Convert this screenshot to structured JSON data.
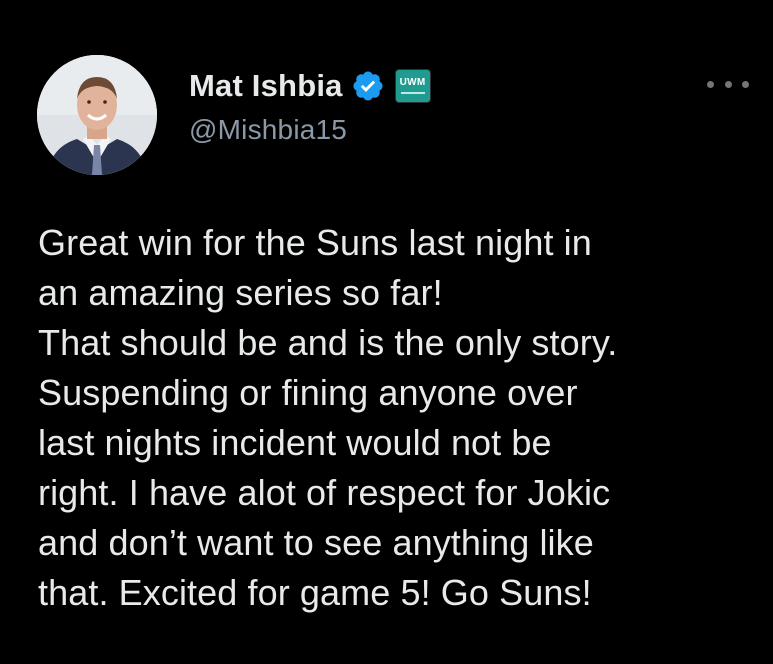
{
  "author": {
    "display_name": "Mat Ishbia",
    "handle": "@Mishbia15",
    "verified_icon": "verified-badge-icon",
    "affiliation": {
      "label": "UWM",
      "color": "#1f9c8f"
    },
    "avatar": "profile-photo"
  },
  "more_icon": "more-horizontal-icon",
  "tweet": {
    "lines": [
      "Great win for the Suns last night in",
      "an amazing series so far!",
      "That should be and is the only story.",
      "Suspending or fining anyone over",
      "last nights incident would not be",
      "right. I have alot of respect for Jokic",
      "and don’t want to see anything like",
      "that. Excited for game 5! Go Suns!"
    ]
  },
  "colors": {
    "background": "#000000",
    "primary_text": "#e7e9ea",
    "secondary_text": "#8b98a5",
    "verified_blue": "#1d9bf0"
  }
}
